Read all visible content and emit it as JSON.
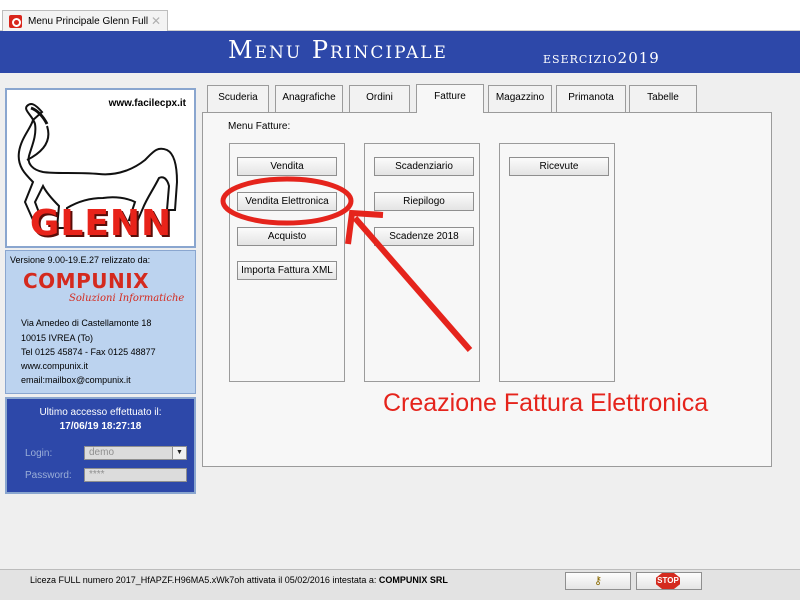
{
  "browser_tab": {
    "title": "Menu Principale Glenn Full",
    "close": "✕"
  },
  "banner": {
    "title": "Menu Principale",
    "year": "esercizio2019"
  },
  "logo": {
    "url": "www.facilecpx.it",
    "word": "GLENN"
  },
  "info": {
    "version": "Versione  9.00-19.E.27  relizzato da:",
    "brand": "COMPUNIX",
    "brand_sub": "Soluzioni Informatiche",
    "address": [
      "Via Amedeo di Castellamonte 18",
      "10015  IVREA    (To)",
      "Tel 0125 45874 - Fax 0125 48877",
      "www.compunix.it",
      "email:mailbox@compunix.it"
    ]
  },
  "login": {
    "access_label": "Ultimo accesso effettuato il:",
    "access_date": "17/06/19 18:27:18",
    "login_label": "Login:",
    "login_value": "demo",
    "password_label": "Password:",
    "password_value": "****"
  },
  "tabs": [
    {
      "label": "Scuderia"
    },
    {
      "label": "Anagrafiche"
    },
    {
      "label": "Ordini"
    },
    {
      "label": "Fatture",
      "active": true
    },
    {
      "label": "Magazzino"
    },
    {
      "label": "Primanota"
    },
    {
      "label": "Tabelle"
    }
  ],
  "section_label": "Menu Fatture:",
  "buttons": {
    "vendita": "Vendita",
    "vendita_elettronica": "Vendita Elettronica",
    "acquisto": "Acquisto",
    "importa_xml": "Importa Fattura XML",
    "scadenziario": "Scadenziario",
    "riepilogo": "Riepilogo",
    "scadenze": "Scadenze 2018",
    "ricevute": "Ricevute"
  },
  "annotation": {
    "text": "Creazione Fattura Elettronica",
    "color": "#e5241c"
  },
  "statusbar": {
    "license": "Liceza FULL numero 2017_HfAPZF.H96MA5.xWk7oh attivata il 05/02/2016 intestata a:",
    "owner": "COMPUNIX SRL",
    "key_icon": "key-icon",
    "stop_label": "STOP"
  },
  "colors": {
    "header_blue": "#2d48a9",
    "info_bg": "#bcd3ef",
    "accent_red": "#d42a1e"
  }
}
